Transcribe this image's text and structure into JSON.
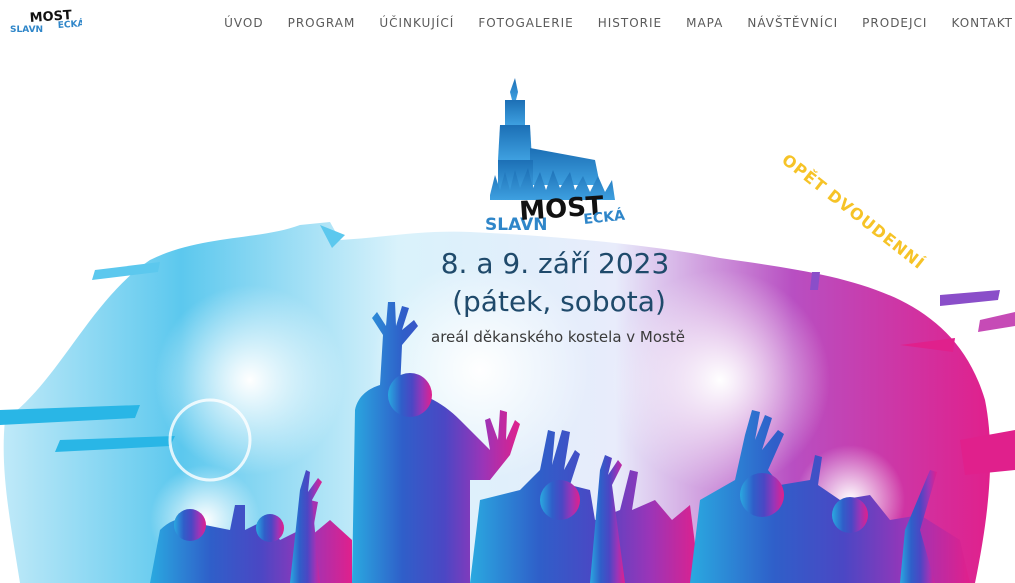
{
  "header": {
    "logo": {
      "text_top": "MOST",
      "text_left": "SLAVN",
      "text_right": "ECKÁ"
    },
    "nav": [
      {
        "label": "ÚVOD"
      },
      {
        "label": "PROGRAM"
      },
      {
        "label": "ÚČINKUJÍCÍ"
      },
      {
        "label": "FOTOGALERIE"
      },
      {
        "label": "HISTORIE"
      },
      {
        "label": "MAPA"
      },
      {
        "label": "NÁVŠTĚVNÍCI"
      },
      {
        "label": "PRODEJCI"
      },
      {
        "label": "KONTAKT"
      }
    ]
  },
  "hero": {
    "badge": "OPĚT DVOUDENNÍ",
    "logo": {
      "text_left": "SLAVN",
      "text_top": "MOST",
      "text_right": "ECKÁ"
    },
    "date_line": "8. a 9. září 2023",
    "days_line": "(pátek, sobota)",
    "venue_line": "areál děkanského kostela v Mostě"
  },
  "colors": {
    "nav_text": "#5a5a5a",
    "date_text": "#1f4a6b",
    "badge": "#f6c327",
    "logo_blue": "#2f86c9",
    "cyan": "#29b6e6",
    "blue": "#2f5fc9",
    "purple": "#7a3fc0",
    "magenta": "#e0208c"
  },
  "icons": {
    "church": "church-tower-icon",
    "crowd": "crowd-silhouette-illustration"
  }
}
